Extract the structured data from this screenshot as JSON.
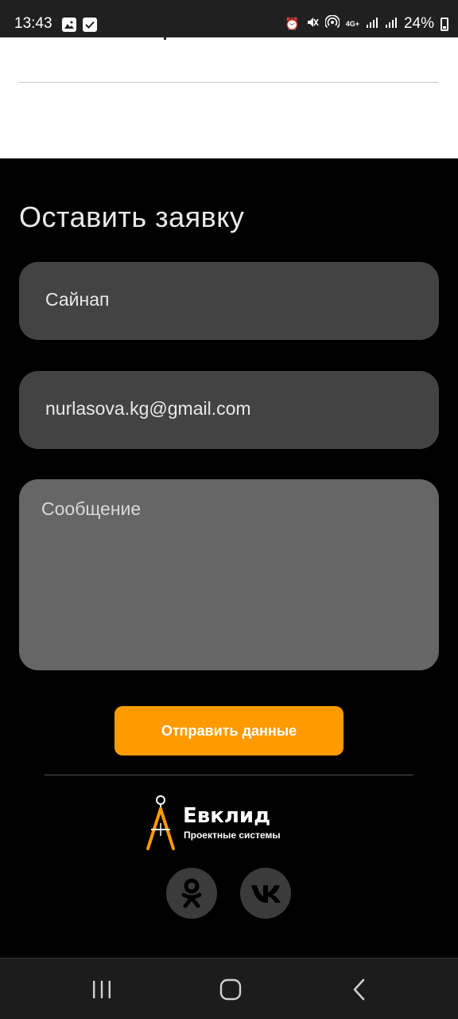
{
  "status_bar": {
    "time": "13:43",
    "left_icons": [
      "image-icon",
      "checkbox-icon"
    ],
    "right_icons": [
      "alarm-icon",
      "mute-icon",
      "hotspot-icon",
      "4g-icon",
      "signal-icon",
      "signal-icon"
    ],
    "network_label": "4G+",
    "battery_percent": "24%"
  },
  "form": {
    "title": "Оставить заявку",
    "name_value": "Сайнап",
    "email_value": "nurlasova.kg@gmail.com",
    "message_placeholder": "Сообщение",
    "submit_label": "Отправить данные"
  },
  "footer": {
    "logo_title": "Евклид",
    "logo_subtitle": "Проектные системы",
    "social": [
      "odnoklassniki-icon",
      "vk-icon"
    ]
  },
  "nav_bar": {
    "buttons": [
      "recent-apps",
      "home",
      "back"
    ]
  },
  "colors": {
    "accent": "#ff9a00",
    "field_bg": "#434343",
    "message_bg": "#666666",
    "page_bg": "#000000"
  }
}
